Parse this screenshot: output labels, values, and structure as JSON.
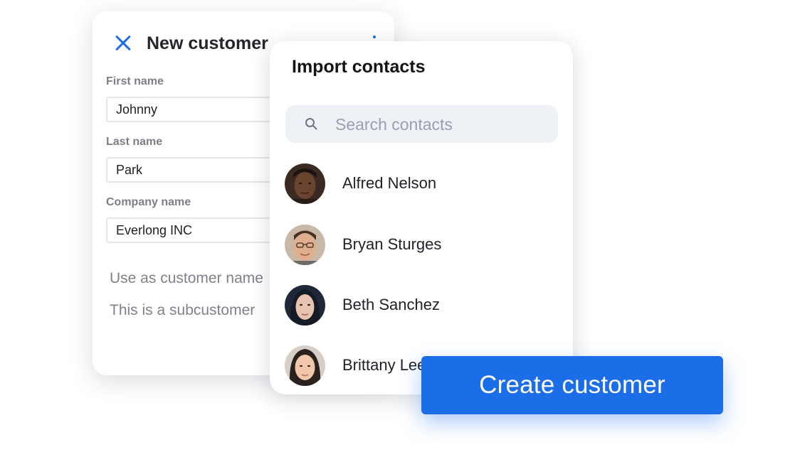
{
  "new_customer": {
    "title": "New customer",
    "fields": [
      {
        "label": "First name",
        "value": "Johnny"
      },
      {
        "label": "Last name",
        "value": "Park"
      },
      {
        "label": "Company name",
        "value": "Everlong INC"
      }
    ],
    "options": [
      "Use as customer name",
      "This is a subcustomer"
    ]
  },
  "import_contacts": {
    "title": "Import contacts",
    "search_placeholder": "Search contacts",
    "contacts": [
      {
        "name": "Alfred Nelson"
      },
      {
        "name": "Bryan Sturges"
      },
      {
        "name": "Beth Sanchez"
      },
      {
        "name": "Brittany Lee"
      }
    ]
  },
  "create_button_label": "Create customer",
  "colors": {
    "accent": "#1c6ee8",
    "label": "#7c7f86",
    "search_bg": "#eef2f7"
  },
  "icons": {
    "close": "close-icon",
    "search": "search-icon",
    "menu": "kebab-menu-icon"
  }
}
